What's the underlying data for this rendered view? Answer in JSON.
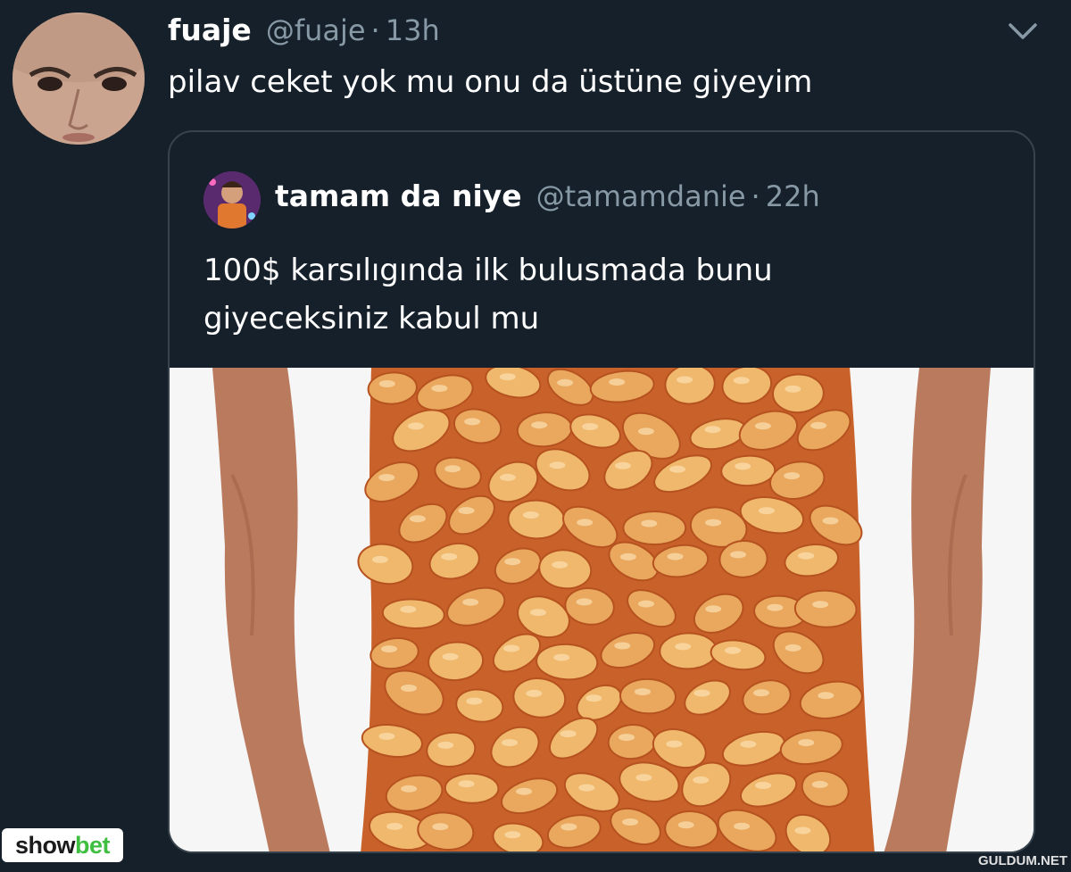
{
  "tweet": {
    "display_name": "fuaje",
    "handle": "@fuaje",
    "separator": "·",
    "time": "13h",
    "text": "pilav ceket yok mu onu da üstüne giyeyim",
    "menu_icon": "chevron-down-icon"
  },
  "quoted_tweet": {
    "display_name": "tamam da niye",
    "handle": "@tamamdanie",
    "separator": "·",
    "time": "22h",
    "text_lines": [
      "100$ karsılıgında ilk bulusmada bunu",
      "giyeceksiniz kabul mu"
    ],
    "media_description_icon": "baked-beans-shirt-photo"
  },
  "watermarks": {
    "showbet_part1": "show",
    "showbet_part2": "bet",
    "guldum": "GULDUM.NET"
  },
  "colors": {
    "background": "#15202b",
    "secondary_text": "#8899a6",
    "border": "#38444d",
    "showbet_green": "#3fbf3f"
  }
}
